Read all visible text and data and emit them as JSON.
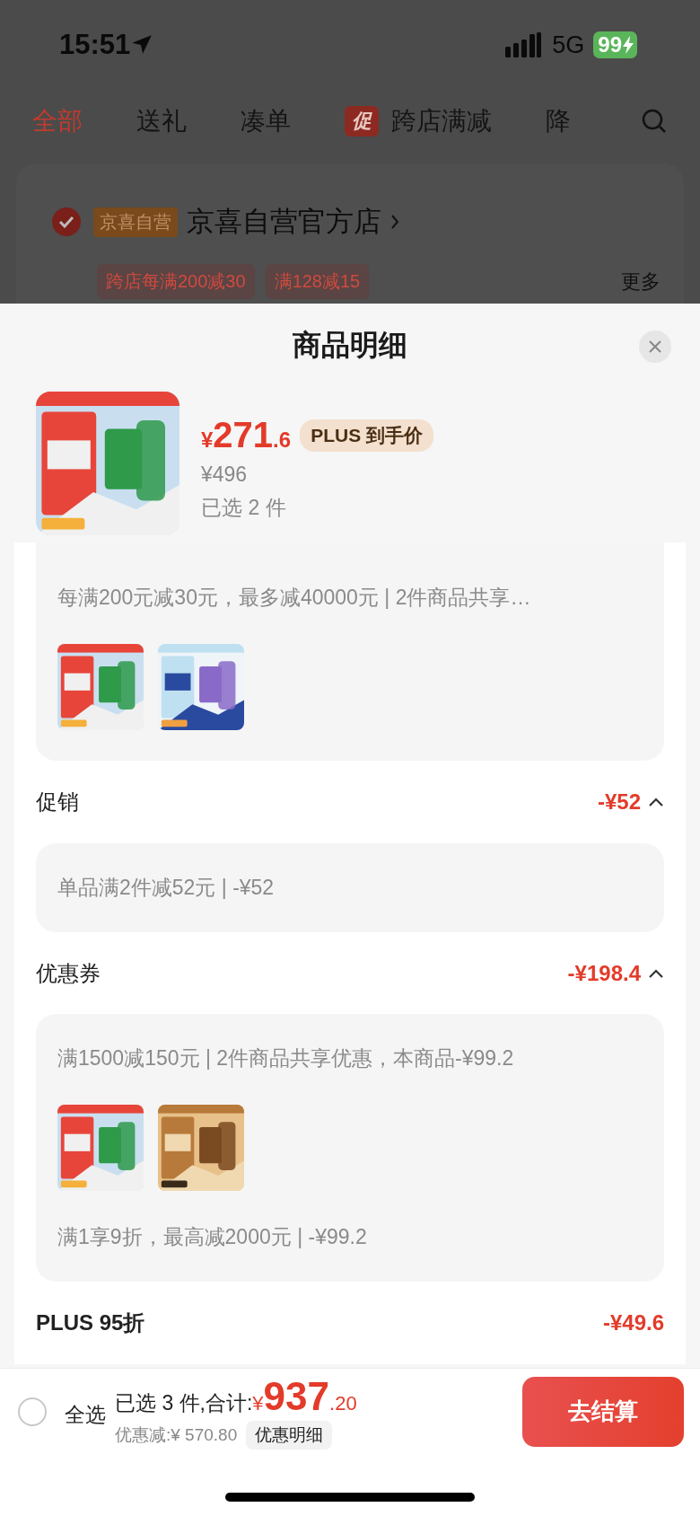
{
  "status_bar": {
    "time": "15:51",
    "network": "5G",
    "battery": "99"
  },
  "tabs": [
    {
      "label": "全部",
      "selected": true
    },
    {
      "label": "送礼",
      "selected": false
    },
    {
      "label": "凑单",
      "selected": false
    },
    {
      "label": "跨店满减",
      "selected": false,
      "badge": "促"
    },
    {
      "label": "降",
      "selected": false
    }
  ],
  "store": {
    "checked": true,
    "tag": "京喜自营",
    "name": "京喜自营官方店",
    "promos": [
      "跨店每满200减30",
      "满128减15"
    ],
    "more": "更多"
  },
  "sheet": {
    "title": "商品明细",
    "product": {
      "currency": "¥",
      "price_int": "271",
      "price_dec": ".6",
      "price_badge": "PLUS 到手价",
      "original_price": "¥496",
      "selected_count": "已选 2 件"
    },
    "sections": [
      {
        "kind": "card",
        "blocks": [
          {
            "kind": "text",
            "text": "每满200元减30元，最多减40000元 | 2件商品共享…"
          },
          {
            "kind": "images"
          }
        ]
      },
      {
        "kind": "group",
        "title": "促销",
        "amount": "-¥52",
        "expanded": true,
        "blocks": [
          {
            "kind": "text",
            "text": "单品满2件减52元 | -¥52"
          }
        ]
      },
      {
        "kind": "group",
        "title": "优惠券",
        "amount": "-¥198.4",
        "expanded": true,
        "blocks": [
          {
            "kind": "text",
            "text": "满1500减150元 | 2件商品共享优惠，本商品-¥99.2"
          },
          {
            "kind": "images"
          },
          {
            "kind": "text",
            "text": "满1享9折，最高减2000元 | -¥99.2"
          }
        ]
      },
      {
        "kind": "line",
        "title": "PLUS 95折",
        "amount": "-¥49.6"
      }
    ]
  },
  "checkout_bar": {
    "select_all": {
      "label": "全选",
      "checked": false
    },
    "summary": "已选 3 件,合计:",
    "currency": "¥",
    "total_int": "937",
    "total_dec": ".20",
    "discount": "优惠减:¥ 570.80",
    "detail_button": "优惠明细",
    "checkout": "去结算"
  }
}
